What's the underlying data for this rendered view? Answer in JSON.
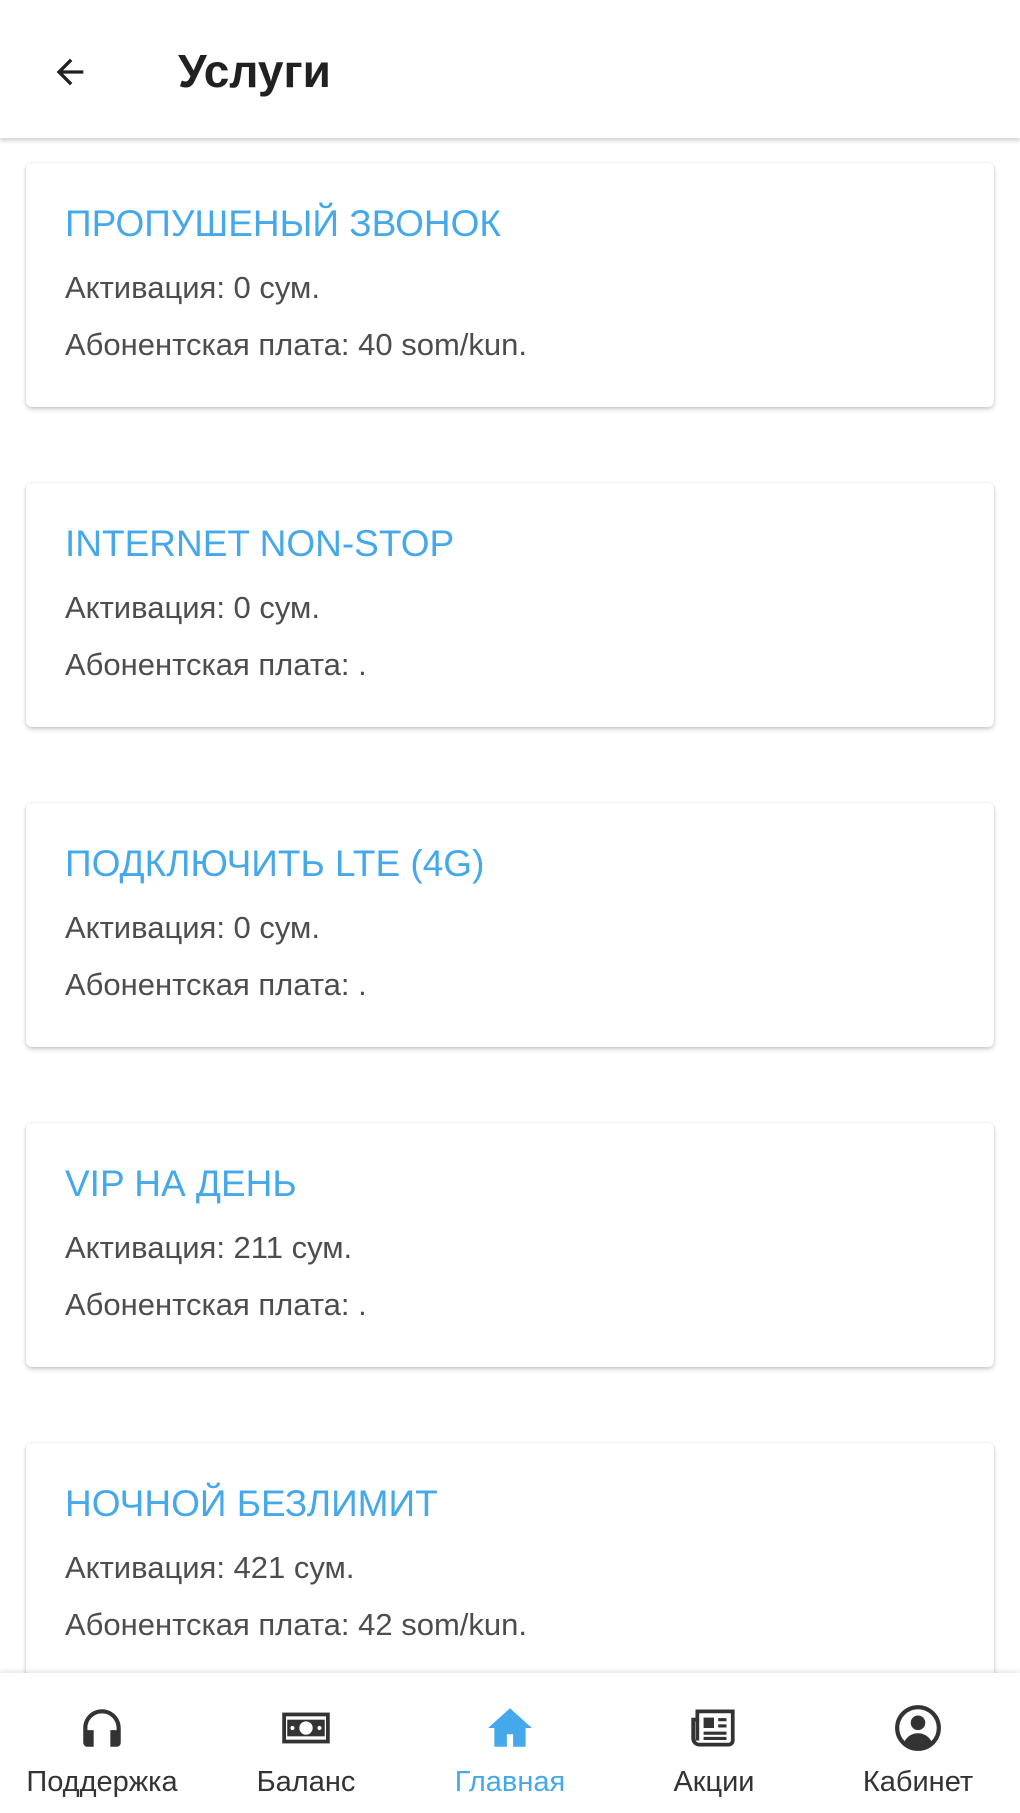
{
  "header": {
    "title": "Услуги"
  },
  "services": [
    {
      "title": "ПРОПУШЕНЫЙ ЗВОНОК",
      "activation": "Активация: 0 сум.",
      "fee": "Абонентская плата: 40 som/kun."
    },
    {
      "title": "INTERNET NON-STOP",
      "activation": "Активация: 0 сум.",
      "fee": "Абонентская плата: ."
    },
    {
      "title": "ПОДКЛЮЧИТЬ LTE (4G)",
      "activation": "Активация: 0 сум.",
      "fee": "Абонентская плата: ."
    },
    {
      "title": "VIP НА ДЕНЬ",
      "activation": "Активация: 211 сум.",
      "fee": "Абонентская плата: ."
    },
    {
      "title": "НОЧНОЙ БЕЗЛИМИТ",
      "activation": "Активация: 421 сум.",
      "fee": "Абонентская плата: 42 som/kun."
    }
  ],
  "bottom_nav": {
    "items": [
      {
        "label": "Поддержка",
        "icon": "headphones-icon"
      },
      {
        "label": "Баланс",
        "icon": "banknote-icon"
      },
      {
        "label": "Главная",
        "icon": "home-icon",
        "active": true
      },
      {
        "label": "Акции",
        "icon": "newspaper-icon"
      },
      {
        "label": "Кабинет",
        "icon": "account-circle-icon"
      }
    ]
  },
  "colors": {
    "accent": "#45a8ea",
    "icon_inactive": "#333333"
  }
}
